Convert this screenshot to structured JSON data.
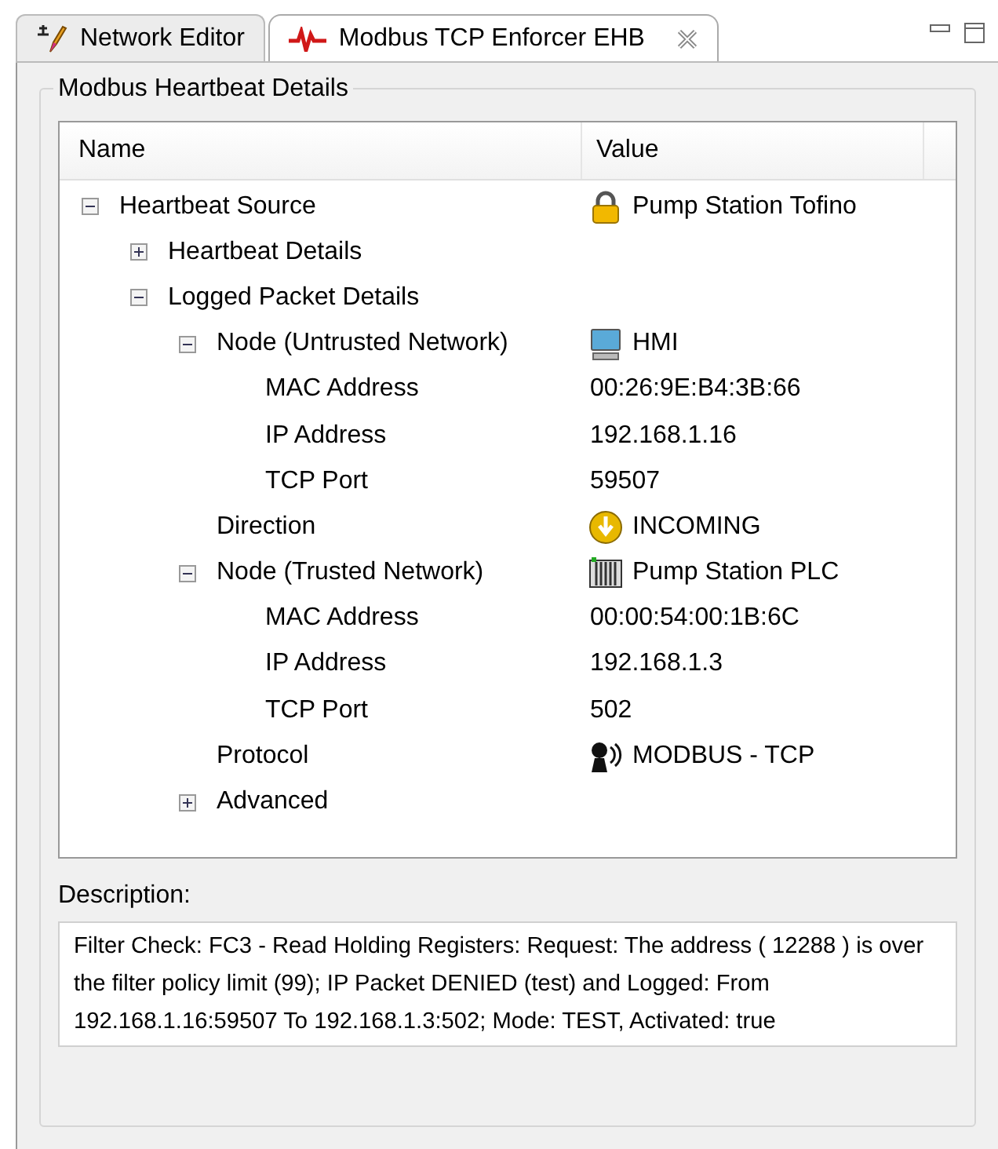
{
  "tabs": [
    {
      "label": "Network Editor",
      "selected": false,
      "closable": false
    },
    {
      "label": "Modbus TCP Enforcer EHB",
      "selected": true,
      "closable": true
    }
  ],
  "group": {
    "title": "Modbus Heartbeat Details"
  },
  "table": {
    "columns": [
      "Name",
      "Value"
    ],
    "rows": [
      {
        "name": "Heartbeat Source",
        "value": "Pump Station Tofino",
        "kind": "device",
        "expanded": true,
        "children": [
          {
            "name": "Heartbeat Details",
            "expanded": false
          },
          {
            "name": "Logged Packet Details",
            "expanded": true,
            "children": [
              {
                "name": "Node (Untrusted Network)",
                "value": "HMI",
                "kind": "workstation",
                "expanded": true,
                "children": [
                  {
                    "name": "MAC Address",
                    "value": "00:26:9E:B4:3B:66"
                  },
                  {
                    "name": "IP Address",
                    "value": "192.168.1.16"
                  },
                  {
                    "name": "TCP Port",
                    "value": "59507"
                  }
                ]
              },
              {
                "name": "Direction",
                "value": "INCOMING",
                "kind": "direction"
              },
              {
                "name": "Node (Trusted Network)",
                "value": "Pump Station PLC",
                "kind": "controller",
                "expanded": true,
                "children": [
                  {
                    "name": "MAC Address",
                    "value": "00:00:54:00:1B:6C"
                  },
                  {
                    "name": "IP Address",
                    "value": "192.168.1.3"
                  },
                  {
                    "name": "TCP Port",
                    "value": "502"
                  }
                ]
              },
              {
                "name": "Protocol",
                "value": "MODBUS - TCP",
                "kind": "protocol"
              },
              {
                "name": "Advanced",
                "expanded": false
              }
            ]
          }
        ]
      }
    ]
  },
  "description": {
    "label": "Description:",
    "text": "Filter Check: FC3 - Read Holding Registers: Request: The address ( 12288 ) is over the filter policy limit (99); IP Packet DENIED (test) and Logged: From 192.168.1.16:59507 To 192.168.1.3:502; Mode: TEST, Activated: true"
  }
}
